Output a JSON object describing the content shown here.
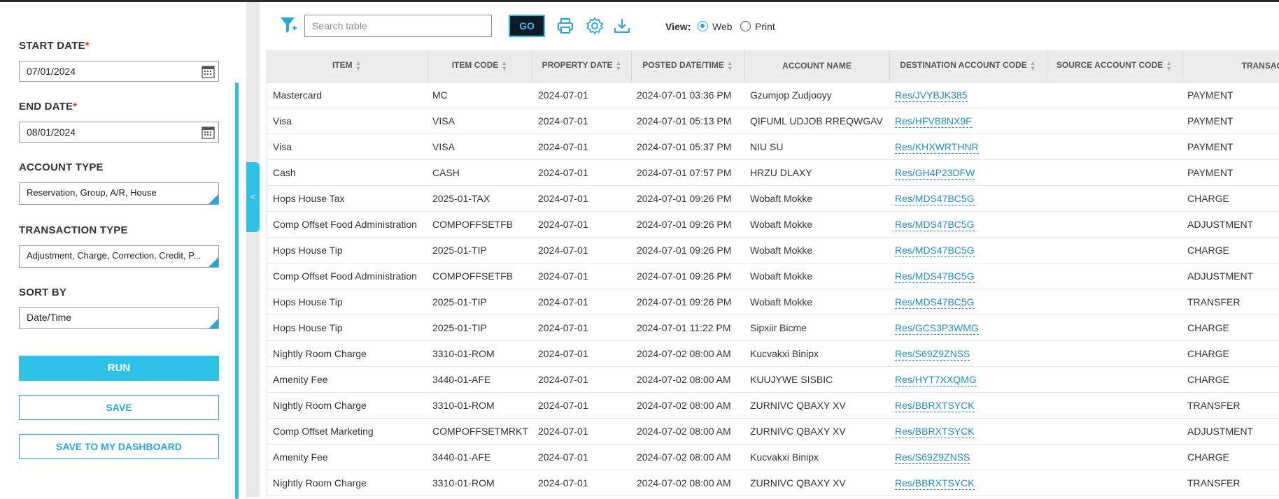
{
  "filters": {
    "start_date": {
      "label": "START DATE",
      "required_mark": "*",
      "value": "07/01/2024"
    },
    "end_date": {
      "label": "END DATE",
      "required_mark": "*",
      "value": "08/01/2024"
    },
    "account_type": {
      "label": "ACCOUNT TYPE",
      "value": "Reservation, Group, A/R, House"
    },
    "transaction_type": {
      "label": "TRANSACTION TYPE",
      "value": "Adjustment, Charge, Correction, Credit, P..."
    },
    "sort_by": {
      "label": "SORT BY",
      "value": "Date/Time"
    },
    "run_label": "RUN",
    "save_label": "SAVE",
    "save_dashboard_label": "SAVE TO MY DASHBOARD",
    "collapse_glyph": "<"
  },
  "toolbar": {
    "search_placeholder": "Search table",
    "go_label": "GO",
    "view_label": "View:",
    "view_options": [
      {
        "label": "Web",
        "selected": true
      },
      {
        "label": "Print",
        "selected": false
      }
    ],
    "icons": [
      "filter-add-icon",
      "printer-icon",
      "gear-icon",
      "download-icon"
    ]
  },
  "colors": {
    "accent": "#2ec3e6",
    "link": "#1e8fc6",
    "go_bg": "#0d1a2a",
    "required": "#e0322a"
  },
  "table": {
    "columns": [
      {
        "label": "ITEM",
        "sortable": true
      },
      {
        "label": "ITEM CODE",
        "sortable": true
      },
      {
        "label": "PROPERTY DATE",
        "sortable": true
      },
      {
        "label": "POSTED DATE/TIME",
        "sortable": true
      },
      {
        "label": "ACCOUNT NAME",
        "sortable": false
      },
      {
        "label": "DESTINATION ACCOUNT CODE",
        "sortable": true
      },
      {
        "label": "SOURCE ACCOUNT CODE",
        "sortable": true
      },
      {
        "label": "TRANSACTION TYPE",
        "sortable": false
      }
    ],
    "rows": [
      [
        "Mastercard",
        "MC",
        "2024-07-01",
        "2024-07-01 03:36 PM",
        "Gzumjop Zudjooyy",
        "Res/JVYBJK385",
        "",
        "PAYMENT"
      ],
      [
        "Visa",
        "VISA",
        "2024-07-01",
        "2024-07-01 05:13 PM",
        "QIFUML UDJOB RREQWGAV",
        "Res/HFVB8NX9F",
        "",
        "PAYMENT"
      ],
      [
        "Visa",
        "VISA",
        "2024-07-01",
        "2024-07-01 05:37 PM",
        "NIU SU",
        "Res/KHXWRTHNR",
        "",
        "PAYMENT"
      ],
      [
        "Cash",
        "CASH",
        "2024-07-01",
        "2024-07-01 07:57 PM",
        "HRZU DLAXY",
        "Res/GH4P23DFW",
        "",
        "PAYMENT"
      ],
      [
        "Hops House Tax",
        "2025-01-TAX",
        "2024-07-01",
        "2024-07-01 09:26 PM",
        "Wobaft Mokke",
        "Res/MDS47BC5G",
        "",
        "CHARGE"
      ],
      [
        "Comp Offset Food Administration",
        "COMPOFFSETFB",
        "2024-07-01",
        "2024-07-01 09:26 PM",
        "Wobaft Mokke",
        "Res/MDS47BC5G",
        "",
        "ADJUSTMENT"
      ],
      [
        "Hops House Tip",
        "2025-01-TIP",
        "2024-07-01",
        "2024-07-01 09:26 PM",
        "Wobaft Mokke",
        "Res/MDS47BC5G",
        "",
        "CHARGE"
      ],
      [
        "Comp Offset Food Administration",
        "COMPOFFSETFB",
        "2024-07-01",
        "2024-07-01 09:26 PM",
        "Wobaft Mokke",
        "Res/MDS47BC5G",
        "",
        "ADJUSTMENT"
      ],
      [
        "Hops House Tip",
        "2025-01-TIP",
        "2024-07-01",
        "2024-07-01 09:26 PM",
        "Wobaft Mokke",
        "Res/MDS47BC5G",
        "",
        "TRANSFER"
      ],
      [
        "Hops House Tip",
        "2025-01-TIP",
        "2024-07-01",
        "2024-07-01 11:22 PM",
        "Sipxiir Bicme",
        "Res/GCS3P3WMG",
        "",
        "CHARGE"
      ],
      [
        "Nightly Room Charge",
        "3310-01-ROM",
        "2024-07-01",
        "2024-07-02 08:00 AM",
        "Kucvakxi Binipx",
        "Res/S69Z9ZNSS",
        "",
        "CHARGE"
      ],
      [
        "Amenity Fee",
        "3440-01-AFE",
        "2024-07-01",
        "2024-07-02 08:00 AM",
        "KUUJYWE SISBIC",
        "Res/HYT7XXQMG",
        "",
        "CHARGE"
      ],
      [
        "Nightly Room Charge",
        "3310-01-ROM",
        "2024-07-01",
        "2024-07-02 08:00 AM",
        "ZURNIVC QBAXY XV",
        "Res/BBRXTSYCK",
        "",
        "TRANSFER"
      ],
      [
        "Comp Offset Marketing",
        "COMPOFFSETMRKT",
        "2024-07-01",
        "2024-07-02 08:00 AM",
        "ZURNIVC QBAXY XV",
        "Res/BBRXTSYCK",
        "",
        "ADJUSTMENT"
      ],
      [
        "Amenity Fee",
        "3440-01-AFE",
        "2024-07-01",
        "2024-07-02 08:00 AM",
        "Kucvakxi Binipx",
        "Res/S69Z9ZNSS",
        "",
        "CHARGE"
      ],
      [
        "Nightly Room Charge",
        "3310-01-ROM",
        "2024-07-01",
        "2024-07-02 08:00 AM",
        "ZURNIVC QBAXY XV",
        "Res/BBRXTSYCK",
        "",
        "TRANSFER"
      ]
    ]
  }
}
